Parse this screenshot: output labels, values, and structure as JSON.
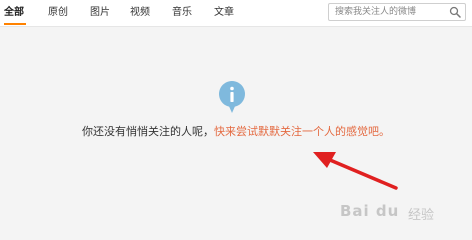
{
  "tabs": [
    {
      "label": "全部",
      "active": true
    },
    {
      "label": "原创"
    },
    {
      "label": "图片"
    },
    {
      "label": "视频"
    },
    {
      "label": "音乐"
    },
    {
      "label": "文章"
    }
  ],
  "search": {
    "placeholder": "搜索我关注人的微博"
  },
  "empty_state": {
    "icon": "info-icon",
    "message_plain": "你还没有悄悄关注的人呢，",
    "message_link": "快来尝试默默关注一个人的感觉吧。"
  },
  "watermark": {
    "logo": "Bai du",
    "suffix": "经验"
  },
  "colors": {
    "accent": "#ff8200",
    "link": "#e46a41",
    "info_icon": "#7fb9dd",
    "arrow": "#e02020"
  }
}
